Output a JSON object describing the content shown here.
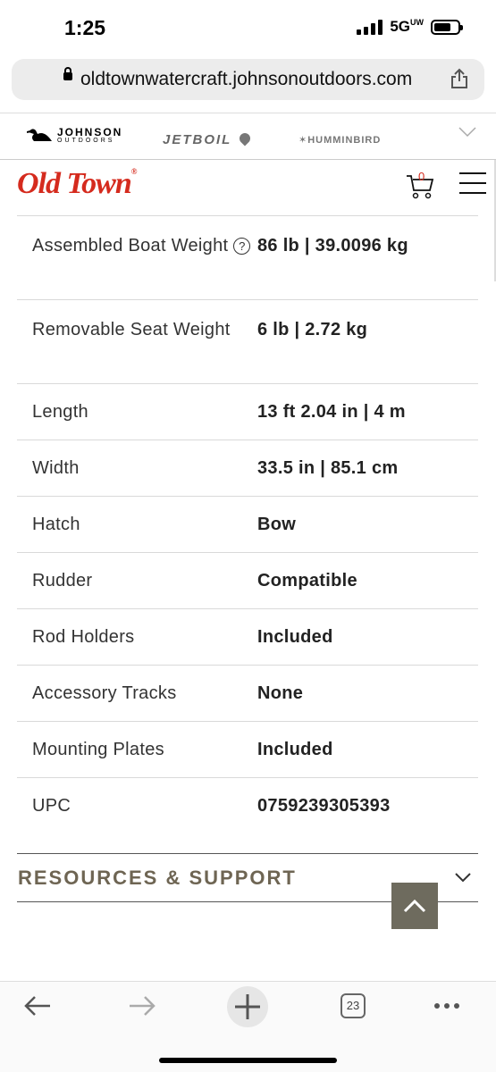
{
  "status_bar": {
    "time": "1:25",
    "network": "5G",
    "network_suffix": "UW"
  },
  "browser": {
    "url": "oldtownwatercraft.johnsonoutdoors.com",
    "tab_count": "23"
  },
  "brand_bar": {
    "johnson_line1": "JOHNSON",
    "johnson_line2": "OUTDOORS",
    "jetboil": "JETBOIL",
    "humminbird": "HUMMINBIRD"
  },
  "header": {
    "logo": "Old Town",
    "cart_count": "0"
  },
  "specs": [
    {
      "label": "Assembled Boat Weight",
      "value": "86 lb | 39.0096 kg"
    },
    {
      "label": "Removable Seat Weight",
      "value": "6 lb | 2.72 kg"
    },
    {
      "label": "Length",
      "value": "13 ft 2.04 in | 4 m"
    },
    {
      "label": "Width",
      "value": "33.5 in | 85.1 cm"
    },
    {
      "label": "Hatch",
      "value": "Bow"
    },
    {
      "label": "Rudder",
      "value": "Compatible"
    },
    {
      "label": "Rod Holders",
      "value": "Included"
    },
    {
      "label": "Accessory Tracks",
      "value": "None"
    },
    {
      "label": "Mounting Plates",
      "value": "Included"
    },
    {
      "label": "UPC",
      "value": "0759239305393"
    }
  ],
  "resources": {
    "title": "RESOURCES & SUPPORT"
  },
  "colors": {
    "brand_red": "#d52b1e",
    "accent_olive": "#6e6553",
    "scroll_btn": "#6e6b5e"
  }
}
